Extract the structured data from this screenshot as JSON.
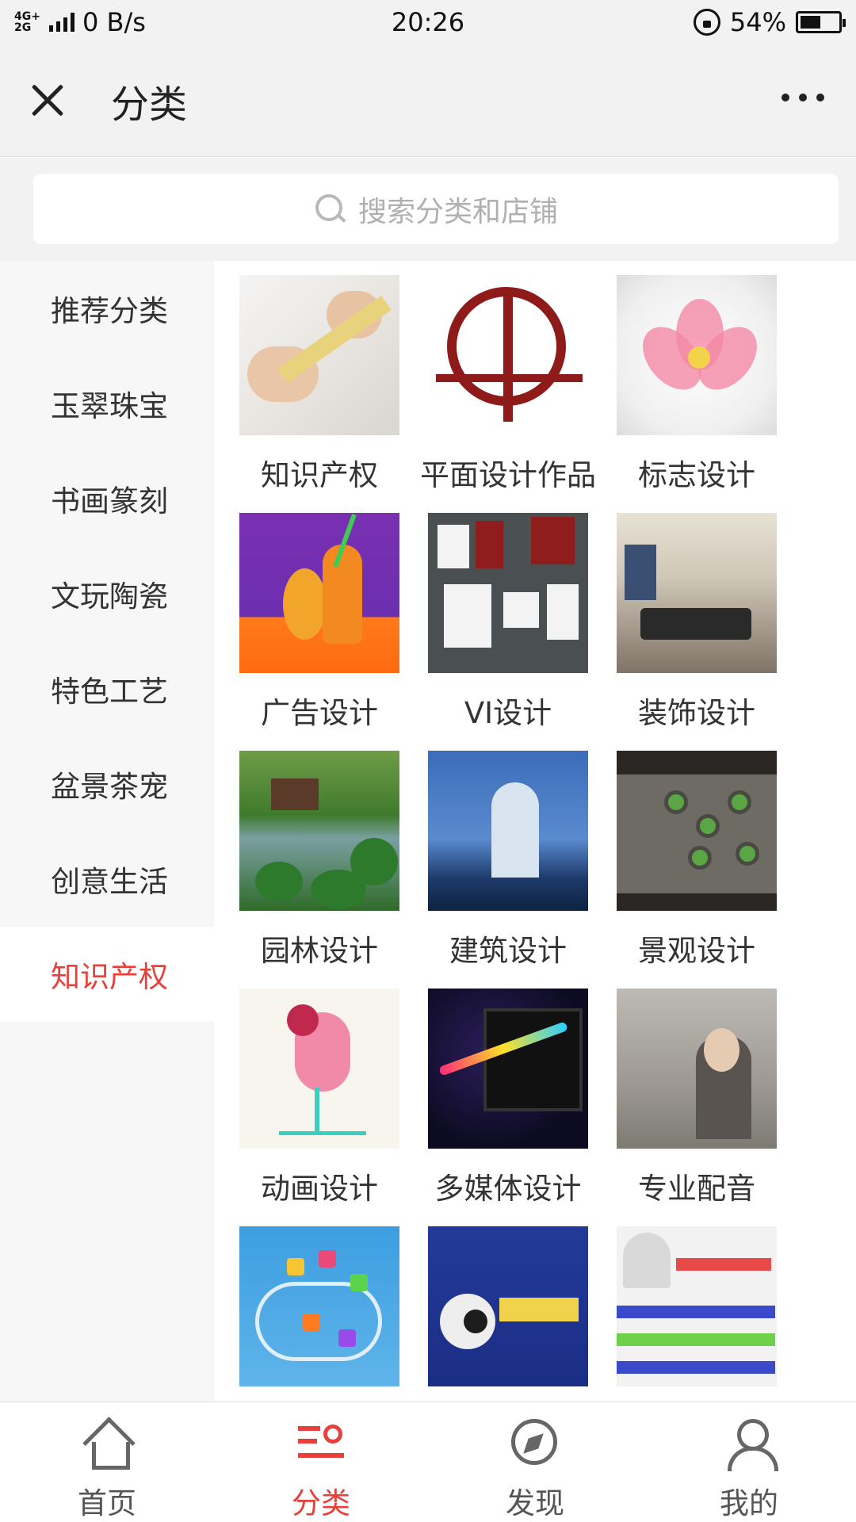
{
  "status_bar": {
    "network": "4G+\n2G",
    "speed": "0 B/s",
    "time": "20:26",
    "battery": "54%",
    "battery_level": 0.54
  },
  "header": {
    "title": "分类",
    "close_icon": "close-icon",
    "more_icon": "more-icon"
  },
  "search": {
    "placeholder": "搜索分类和店铺",
    "icon": "search-icon"
  },
  "sidebar": {
    "items": [
      {
        "label": "推荐分类",
        "active": false
      },
      {
        "label": "玉翠珠宝",
        "active": false
      },
      {
        "label": "书画篆刻",
        "active": false
      },
      {
        "label": "文玩陶瓷",
        "active": false
      },
      {
        "label": "特色工艺",
        "active": false
      },
      {
        "label": "盆景茶宠",
        "active": false
      },
      {
        "label": "创意生活",
        "active": false
      },
      {
        "label": "知识产权",
        "active": true
      }
    ]
  },
  "grid": {
    "items": [
      {
        "label": "知识产权"
      },
      {
        "label": "平面设计作品"
      },
      {
        "label": "标志设计"
      },
      {
        "label": "广告设计"
      },
      {
        "label": "VI设计"
      },
      {
        "label": "装饰设计"
      },
      {
        "label": "园林设计"
      },
      {
        "label": "建筑设计"
      },
      {
        "label": "景观设计"
      },
      {
        "label": "动画设计"
      },
      {
        "label": "多媒体设计"
      },
      {
        "label": "专业配音"
      },
      {
        "label": ""
      },
      {
        "label": ""
      },
      {
        "label": ""
      }
    ]
  },
  "tabbar": {
    "tabs": [
      {
        "label": "首页",
        "icon": "home-icon",
        "active": false
      },
      {
        "label": "分类",
        "icon": "category-icon",
        "active": true
      },
      {
        "label": "发现",
        "icon": "compass-icon",
        "active": false
      },
      {
        "label": "我的",
        "icon": "user-icon",
        "active": false
      }
    ]
  },
  "colors": {
    "accent": "#e8413b",
    "background": "#f2f2f2",
    "sidebar_bg": "#f7f7f7"
  }
}
